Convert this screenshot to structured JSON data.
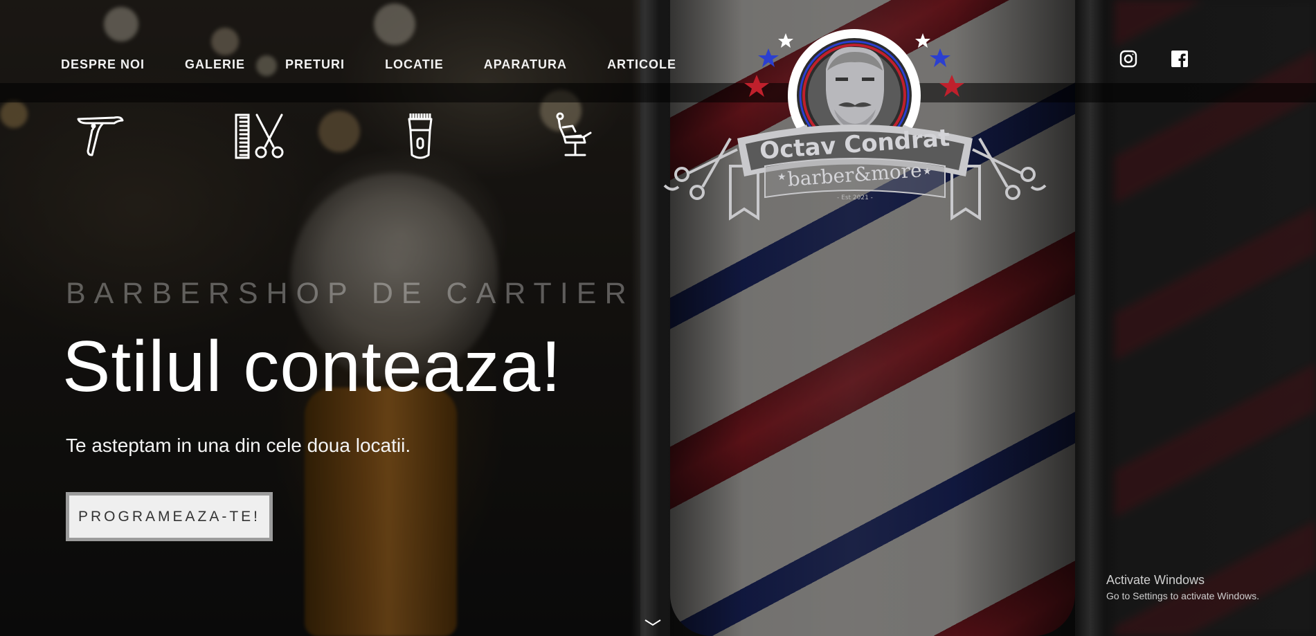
{
  "nav": {
    "items": [
      {
        "label": "DESPRE NOI"
      },
      {
        "label": "GALERIE"
      },
      {
        "label": "PRETURI"
      },
      {
        "label": "LOCATIE"
      },
      {
        "label": "APARATURA"
      },
      {
        "label": "ARTICOLE"
      }
    ]
  },
  "service_icons": [
    "straight-razor-icon",
    "comb-scissors-icon",
    "hair-clipper-icon",
    "barber-chair-icon"
  ],
  "logo": {
    "name": "Octav Condrat",
    "tagline": "barber&more",
    "established": "- Est 2021 -"
  },
  "social": {
    "instagram": "instagram-icon",
    "facebook": "facebook-icon"
  },
  "hero": {
    "tagline": "BARBERSHOP DE CARTIER",
    "headline": "Stilul conteaza!",
    "subline": "Te asteptam in una din cele doua locatii.",
    "cta_label": "PROGRAMEAZA-TE!"
  },
  "windows_watermark": {
    "title": "Activate Windows",
    "subtitle": "Go to Settings to activate Windows."
  },
  "colors": {
    "accent_red": "#c0202c",
    "accent_blue": "#2b3fd0",
    "silver": "#c9c9cc"
  }
}
